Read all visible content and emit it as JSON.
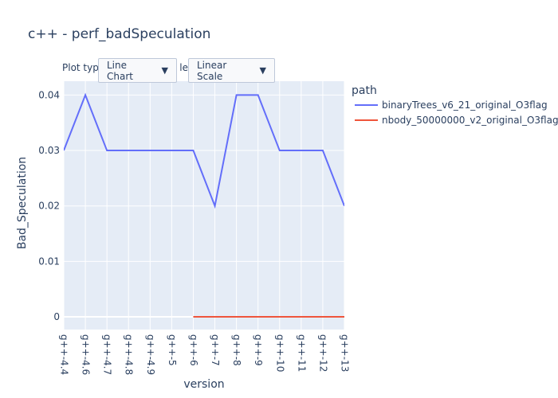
{
  "title": "c++ - perf_badSpeculation",
  "controls": {
    "plot_type_label": "Plot type",
    "plot_type_value": "Line Chart",
    "scale_label": "Scale",
    "scale_value": "Linear Scale",
    "arrow": "▼"
  },
  "colors": {
    "plot_bg": "#e5ecf6",
    "grid": "#ffffff",
    "series1": "#636efa",
    "series2": "#ef553b"
  },
  "chart_data": {
    "type": "line",
    "title": "c++ - perf_badSpeculation",
    "xlabel": "version",
    "ylabel": "Bad_Speculation",
    "categories": [
      "g++-4.4",
      "g++-4.6",
      "g++-4.7",
      "g++-4.8",
      "g++-4.9",
      "g++-5",
      "g++-6",
      "g++-7",
      "g++-8",
      "g++-9",
      "g++-10",
      "g++-11",
      "g++-12",
      "g++-13"
    ],
    "yticks": [
      0,
      0.01,
      0.02,
      0.03,
      0.04
    ],
    "ytick_labels": [
      "0",
      "0.01",
      "0.02",
      "0.03",
      "0.04"
    ],
    "ylim": [
      -0.0023,
      0.0425
    ],
    "grid": true,
    "legend_title": "path",
    "legend_position": "right",
    "series": [
      {
        "name": "binaryTrees_v6_21_original_O3flag",
        "values": [
          0.03,
          0.04,
          0.03,
          0.03,
          0.03,
          0.03,
          0.03,
          0.02,
          0.04,
          0.04,
          0.03,
          0.03,
          0.03,
          0.02
        ]
      },
      {
        "name": "nbody_50000000_v2_original_O3flag",
        "values": [
          null,
          null,
          null,
          null,
          null,
          null,
          0,
          0,
          0,
          0,
          0,
          0,
          0,
          0
        ]
      }
    ]
  }
}
